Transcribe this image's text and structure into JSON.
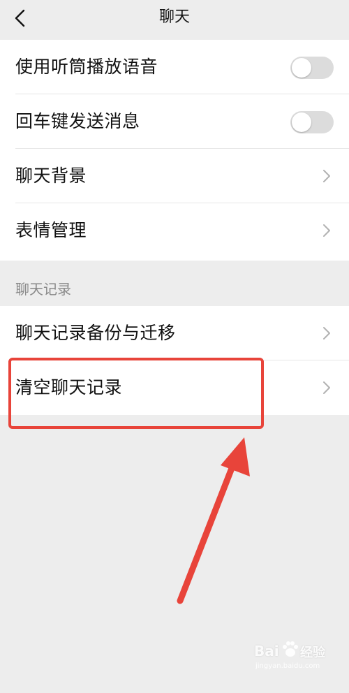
{
  "nav": {
    "title": "聊天"
  },
  "settings": {
    "rows": [
      {
        "label": "使用听筒播放语音",
        "control": "toggle",
        "enabled": false
      },
      {
        "label": "回车键发送消息",
        "control": "toggle",
        "enabled": false
      },
      {
        "label": "聊天背景",
        "control": "chevron"
      },
      {
        "label": "表情管理",
        "control": "chevron"
      }
    ]
  },
  "chat_history": {
    "header": "聊天记录",
    "rows": [
      {
        "label": "聊天记录备份与迁移",
        "control": "chevron"
      },
      {
        "label": "清空聊天记录",
        "control": "chevron"
      }
    ]
  },
  "annotation": {
    "color": "#e8443a"
  },
  "watermark": {
    "brand": "Bai",
    "brand_suffix": "经验",
    "sub": "jingyan.baidu.com"
  },
  "colors": {
    "background": "#ededed",
    "row_background": "#ffffff",
    "toggle_off": "#dcdcdc",
    "chevron": "#b2b2b2",
    "section_header": "#888888"
  }
}
